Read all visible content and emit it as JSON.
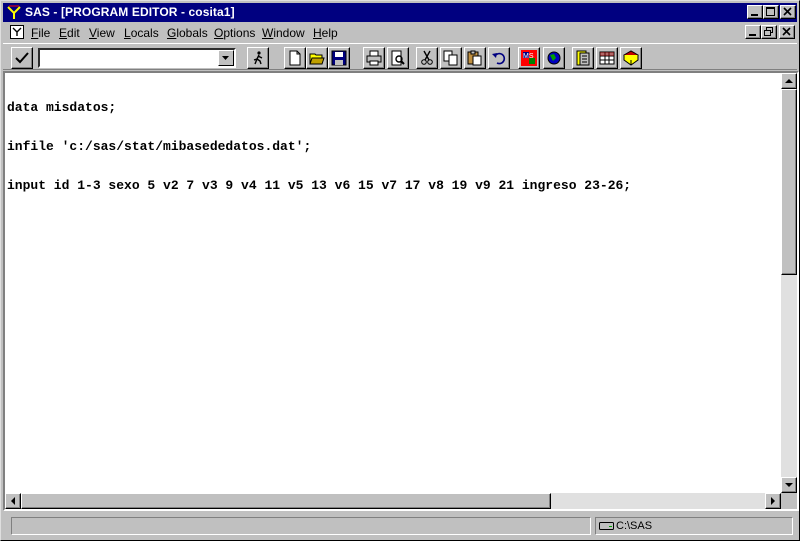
{
  "window": {
    "title": "SAS - [PROGRAM EDITOR - cosita1]"
  },
  "menu": {
    "items": [
      {
        "label": "File",
        "key": "F",
        "rest": "ile"
      },
      {
        "label": "Edit",
        "key": "E",
        "rest": "dit"
      },
      {
        "label": "View",
        "key": "V",
        "rest": "iew"
      },
      {
        "label": "Locals",
        "key": "L",
        "rest": "ocals"
      },
      {
        "label": "Globals",
        "key": "G",
        "rest": "lobals"
      },
      {
        "label": "Options",
        "key": "O",
        "rest": "ptions"
      },
      {
        "label": "Window",
        "key": "W",
        "rest": "indow"
      },
      {
        "label": "Help",
        "key": "H",
        "rest": "elp"
      }
    ]
  },
  "toolbar": {
    "command_value": "",
    "icons": [
      "submit-check-icon",
      "run-icon",
      "new-icon",
      "open-icon",
      "save-icon",
      "print-icon",
      "print-preview-icon",
      "cut-icon",
      "copy-icon",
      "paste-icon",
      "undo-icon",
      "ms-office-icon",
      "globe-icon",
      "library-icon",
      "table-icon",
      "help-book-icon"
    ]
  },
  "editor": {
    "lines": [
      "data misdatos;",
      "infile 'c:/sas/stat/mibasededatos.dat';",
      "input id 1-3 sexo 5 v2 7 v3 9 v4 11 v5 13 v6 15 v7 17 v8 19 v9 21 ingreso 23-26;"
    ]
  },
  "status": {
    "message": "",
    "path": "C:\\SAS"
  }
}
